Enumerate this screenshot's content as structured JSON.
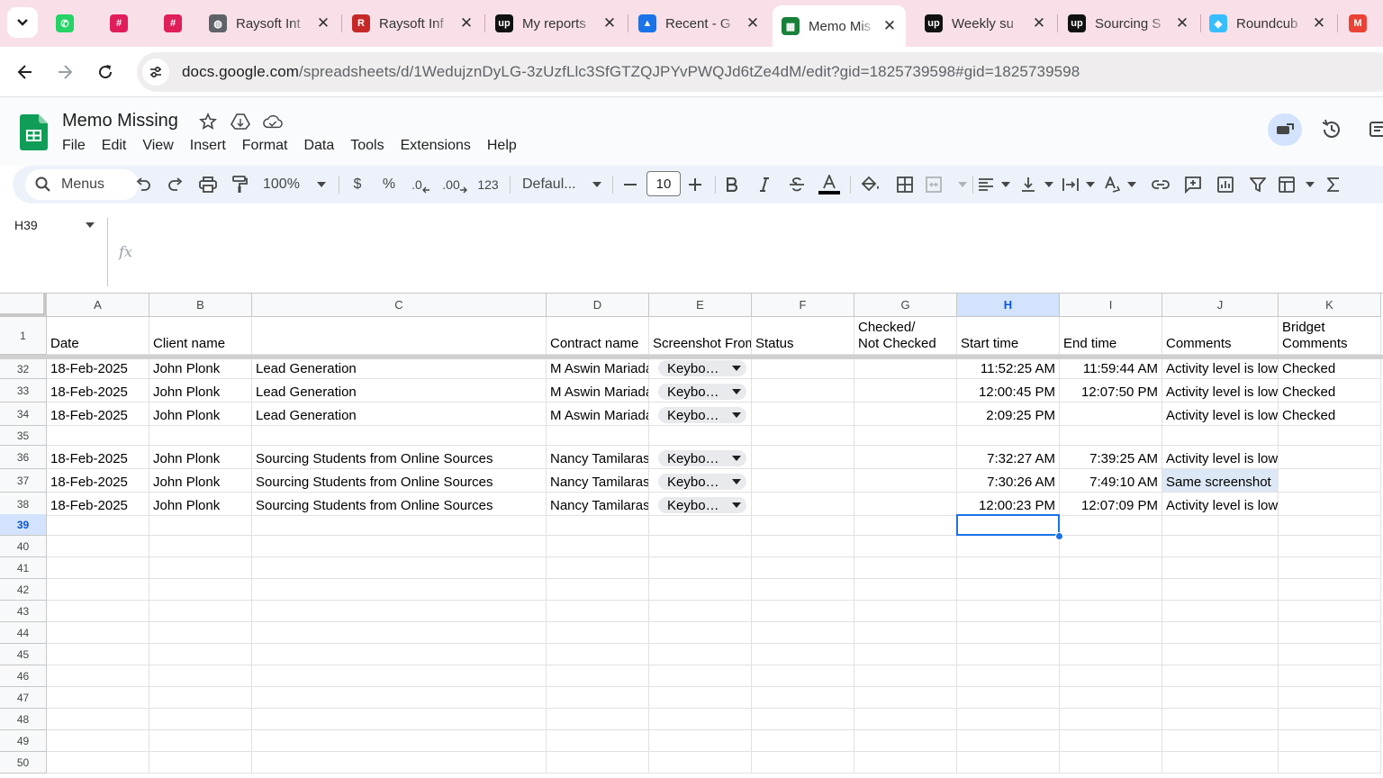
{
  "tabs": [
    {
      "label": "",
      "icon": "whatsapp-icon",
      "color": "#25d366"
    },
    {
      "label": "",
      "icon": "slack-icon",
      "color": "#e01e5a"
    },
    {
      "label": "",
      "icon": "slack-icon",
      "color": "#e01e5a"
    },
    {
      "label": "Raysoft Int",
      "icon": "globe-icon",
      "color": "#5f6368"
    },
    {
      "label": "Raysoft Inf",
      "icon": "raysoft-icon",
      "color": "#c62828"
    },
    {
      "label": "My reports",
      "icon": "upwork-icon",
      "color": "#111111"
    },
    {
      "label": "Recent - G",
      "icon": "drive-icon",
      "color": "#1a73e8"
    },
    {
      "label": "Memo Mis",
      "icon": "sheets-icon",
      "color": "#188038"
    },
    {
      "label": "Weekly su",
      "icon": "upwork-icon",
      "color": "#111111"
    },
    {
      "label": "Sourcing S",
      "icon": "upwork-icon",
      "color": "#111111"
    },
    {
      "label": "Roundcub",
      "icon": "roundcube-icon",
      "color": "#37beff"
    },
    {
      "label": "",
      "icon": "gmail-icon",
      "color": "#ea4335"
    }
  ],
  "address": {
    "host": "docs.google.com",
    "path": "/spreadsheets/d/1WedujznDyLG-3zUzfLlc3SfGTZQJPYvPWQJd6tZe4dM/edit?gid=1825739598#gid=1825739598"
  },
  "doc": {
    "title": "Memo Missing",
    "menus": [
      "File",
      "Edit",
      "View",
      "Insert",
      "Format",
      "Data",
      "Tools",
      "Extensions",
      "Help"
    ]
  },
  "toolbar": {
    "search_label": "Menus",
    "zoom": "100%",
    "currency": "$",
    "percent": "%",
    "dec_decrease": ".0",
    "dec_increase": ".00",
    "number_format": "123",
    "font": "Defaul...",
    "font_size": "10"
  },
  "formula_bar": {
    "cell_ref": "H39",
    "fx": "fx",
    "content": ""
  },
  "grid": {
    "columns": [
      "A",
      "B",
      "C",
      "D",
      "E",
      "F",
      "G",
      "H",
      "I",
      "J",
      "K"
    ],
    "selected_column": "H",
    "header_row": {
      "num": "1",
      "cells": [
        "Date",
        "Client name",
        "",
        "Contract name",
        "Screenshot From",
        "Status",
        "Checked/\nNot Checked",
        "Start time",
        "End time",
        "Comments",
        "Bridget\nComments"
      ]
    },
    "rows": [
      {
        "num": "32",
        "cells": [
          "18-Feb-2025",
          "John Plonk",
          "Lead Generation",
          "M Aswin Mariadas",
          "Keyboard",
          "",
          "",
          "11:52:25 AM",
          "11:59:44 AM",
          "Activity level is low",
          "Checked"
        ]
      },
      {
        "num": "33",
        "cells": [
          "18-Feb-2025",
          "John Plonk",
          "Lead Generation",
          "M Aswin Mariadas",
          "Keyboard",
          "",
          "",
          "12:00:45 PM",
          "12:07:50 PM",
          "Activity level is low",
          "Checked"
        ]
      },
      {
        "num": "34",
        "cells": [
          "18-Feb-2025",
          "John Plonk",
          "Lead Generation",
          "M Aswin Mariadas",
          "Keyboard",
          "",
          "",
          "2:09:25 PM",
          "",
          "Activity level is low",
          "Checked"
        ]
      },
      {
        "num": "35",
        "cells": [
          "",
          "",
          "",
          "",
          "",
          "",
          "",
          "",
          "",
          "",
          ""
        ]
      },
      {
        "num": "36",
        "cells": [
          "18-Feb-2025",
          "John Plonk",
          "Sourcing Students from Online Sources",
          "Nancy Tamilarasi",
          "Keyboard",
          "",
          "",
          "7:32:27 AM",
          "7:39:25 AM",
          "Activity level is low",
          ""
        ]
      },
      {
        "num": "37",
        "cells": [
          "18-Feb-2025",
          "John Plonk",
          "Sourcing Students from Online Sources",
          "Nancy Tamilarasi",
          "Keyboard",
          "",
          "",
          "7:30:26 AM",
          "7:49:10 AM",
          "Same screenshot",
          ""
        ]
      },
      {
        "num": "38",
        "cells": [
          "18-Feb-2025",
          "John Plonk",
          "Sourcing Students from Online Sources",
          "Nancy Tamilarasi",
          "Keyboard",
          "",
          "",
          "12:00:23 PM",
          "12:07:09 PM",
          "Activity level is low",
          ""
        ]
      },
      {
        "num": "39",
        "cells": [
          "",
          "",
          "",
          "",
          "",
          "",
          "",
          "",
          "",
          "",
          ""
        ]
      },
      {
        "num": "40",
        "cells": [
          "",
          "",
          "",
          "",
          "",
          "",
          "",
          "",
          "",
          "",
          ""
        ]
      },
      {
        "num": "41",
        "cells": [
          "",
          "",
          "",
          "",
          "",
          "",
          "",
          "",
          "",
          "",
          ""
        ]
      },
      {
        "num": "42",
        "cells": [
          "",
          "",
          "",
          "",
          "",
          "",
          "",
          "",
          "",
          "",
          ""
        ]
      },
      {
        "num": "43",
        "cells": [
          "",
          "",
          "",
          "",
          "",
          "",
          "",
          "",
          "",
          "",
          ""
        ]
      },
      {
        "num": "44",
        "cells": [
          "",
          "",
          "",
          "",
          "",
          "",
          "",
          "",
          "",
          "",
          ""
        ]
      },
      {
        "num": "45",
        "cells": [
          "",
          "",
          "",
          "",
          "",
          "",
          "",
          "",
          "",
          "",
          ""
        ]
      },
      {
        "num": "46",
        "cells": [
          "",
          "",
          "",
          "",
          "",
          "",
          "",
          "",
          "",
          "",
          ""
        ]
      },
      {
        "num": "47",
        "cells": [
          "",
          "",
          "",
          "",
          "",
          "",
          "",
          "",
          "",
          "",
          ""
        ]
      },
      {
        "num": "48",
        "cells": [
          "",
          "",
          "",
          "",
          "",
          "",
          "",
          "",
          "",
          "",
          ""
        ]
      },
      {
        "num": "49",
        "cells": [
          "",
          "",
          "",
          "",
          "",
          "",
          "",
          "",
          "",
          "",
          ""
        ]
      },
      {
        "num": "50",
        "cells": [
          "",
          "",
          "",
          "",
          "",
          "",
          "",
          "",
          "",
          "",
          ""
        ]
      }
    ],
    "selected_row": "39",
    "highlight_color": "#dde8f6",
    "selection_color": "#1a73e8"
  }
}
